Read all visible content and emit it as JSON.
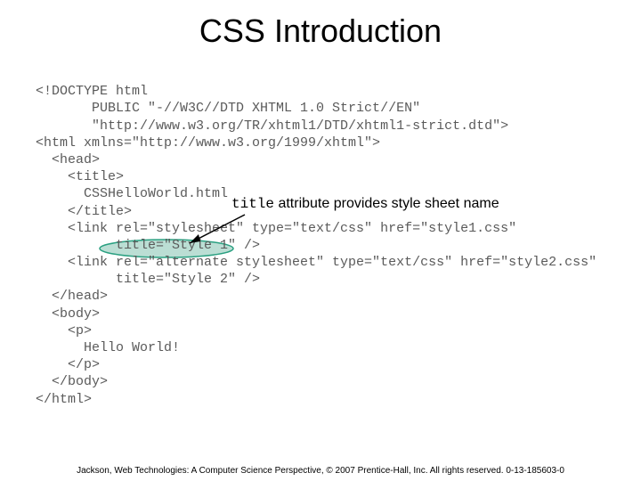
{
  "title": "CSS Introduction",
  "annotation": {
    "mono": "title",
    "rest": " attribute provides style sheet name"
  },
  "code": {
    "l1": "<!DOCTYPE html",
    "l2": "       PUBLIC \"-//W3C//DTD XHTML 1.0 Strict//EN\"",
    "l3": "       \"http://www.w3.org/TR/xhtml1/DTD/xhtml1-strict.dtd\">",
    "l4": "<html xmlns=\"http://www.w3.org/1999/xhtml\">",
    "l5": "  <head>",
    "l6": "    <title>",
    "l7": "      CSSHelloWorld.html",
    "l8": "    </title>",
    "l9": "    <link rel=\"stylesheet\" type=\"text/css\" href=\"style1.css\"",
    "l10": "          title=\"Style 1\" />",
    "l11": "    <link rel=\"alternate stylesheet\" type=\"text/css\" href=\"style2.css\"",
    "l12": "          title=\"Style 2\" />",
    "l13": "  </head>",
    "l14": "  <body>",
    "l15": "    <p>",
    "l16": "      Hello World!",
    "l17": "    </p>",
    "l18": "  </body>",
    "l19": "</html>"
  },
  "footer": "Jackson, Web Technologies: A Computer Science Perspective, © 2007 Prentice-Hall, Inc. All rights reserved. 0-13-185603-0"
}
